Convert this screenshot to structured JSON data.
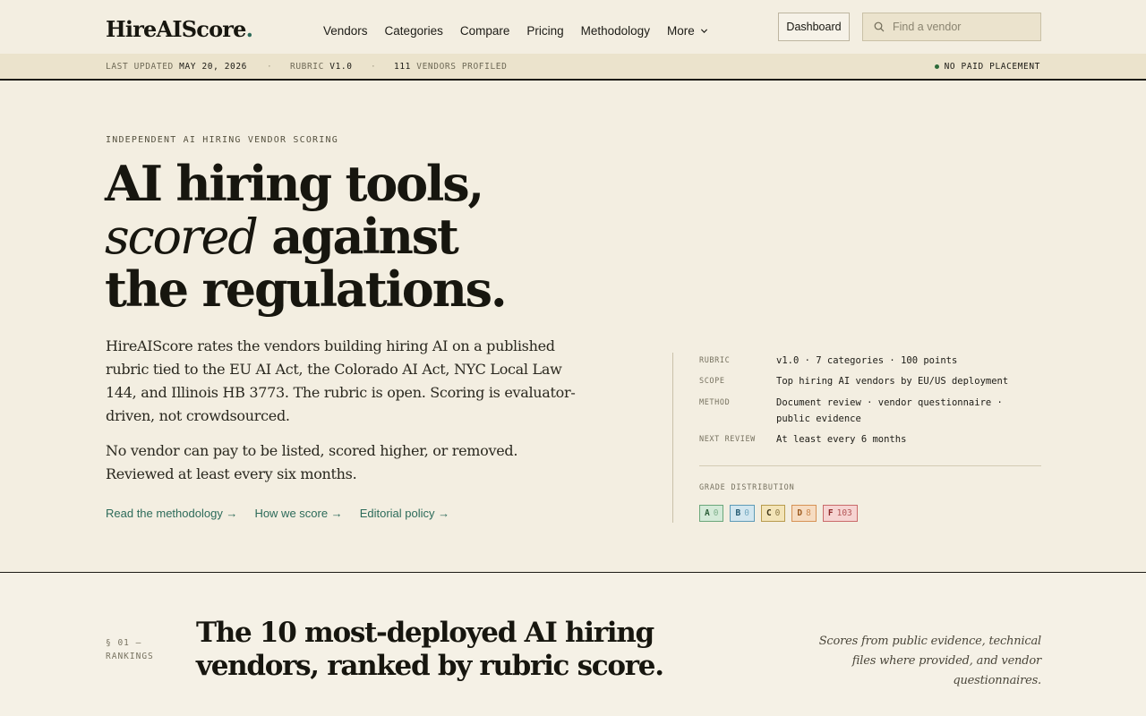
{
  "brand": {
    "name": "HireAIScore",
    "dot": "."
  },
  "nav": {
    "items": [
      "Vendors",
      "Categories",
      "Compare",
      "Pricing",
      "Methodology"
    ],
    "more_label": "More"
  },
  "header": {
    "dashboard_label": "Dashboard",
    "search_placeholder": "Find a vendor"
  },
  "meta_bar": {
    "last_updated_label": "LAST UPDATED",
    "last_updated_value": "MAY 20, 2026",
    "rubric_label": "RUBRIC",
    "rubric_value": "V1.0",
    "vendors_count": "111",
    "vendors_label": "VENDORS PROFILED",
    "separator": "·",
    "no_paid": "NO PAID PLACEMENT"
  },
  "hero": {
    "eyebrow": "INDEPENDENT AI HIRING VENDOR SCORING",
    "line1": "AI hiring tools,",
    "line2_em": "scored",
    "line2_rest": " against",
    "line3": "the regulations.",
    "lede": "HireAIScore rates the vendors building hiring AI on a published rubric tied to the EU AI Act, the Colorado AI Act, NYC Local Law 144, and Illinois HB 3773. The rubric is open. Scoring is evaluator-driven, not crowdsourced.",
    "lede2": "No vendor can pay to be listed, scored higher, or removed. Reviewed at least every six months.",
    "links": [
      "Read the methodology →",
      "How we score →",
      "Editorial policy →"
    ]
  },
  "panel": {
    "rows": [
      {
        "key": "RUBRIC",
        "value": "v1.0 · 7 categories · 100 points"
      },
      {
        "key": "SCOPE",
        "value": "Top hiring AI vendors by EU/US deployment"
      },
      {
        "key": "METHOD",
        "value": "Document review · vendor questionnaire · public evidence"
      },
      {
        "key": "NEXT REVIEW",
        "value": "At least every 6 months"
      }
    ],
    "grade_label": "GRADE DISTRIBUTION",
    "grades": [
      {
        "letter": "A",
        "count": "0",
        "color": "#d4ead8"
      },
      {
        "letter": "B",
        "count": "0",
        "color": "#d2e6ef"
      },
      {
        "letter": "C",
        "count": "0",
        "color": "#f3e4b8"
      },
      {
        "letter": "D",
        "count": "8",
        "color": "#f6dcc2"
      },
      {
        "letter": "F",
        "count": "103",
        "color": "#f6d4d2"
      }
    ]
  },
  "rankings": {
    "section_num": "§ 01 — RANKINGS",
    "title": "The 10 most-deployed AI hiring vendors, ranked by rubric score.",
    "note": "Scores from public evidence, technical files where provided, and vendor questionnaires."
  },
  "colors": {
    "accent": "#2d6b5a",
    "background": "#f3eee1",
    "ink": "#1c1b16"
  }
}
